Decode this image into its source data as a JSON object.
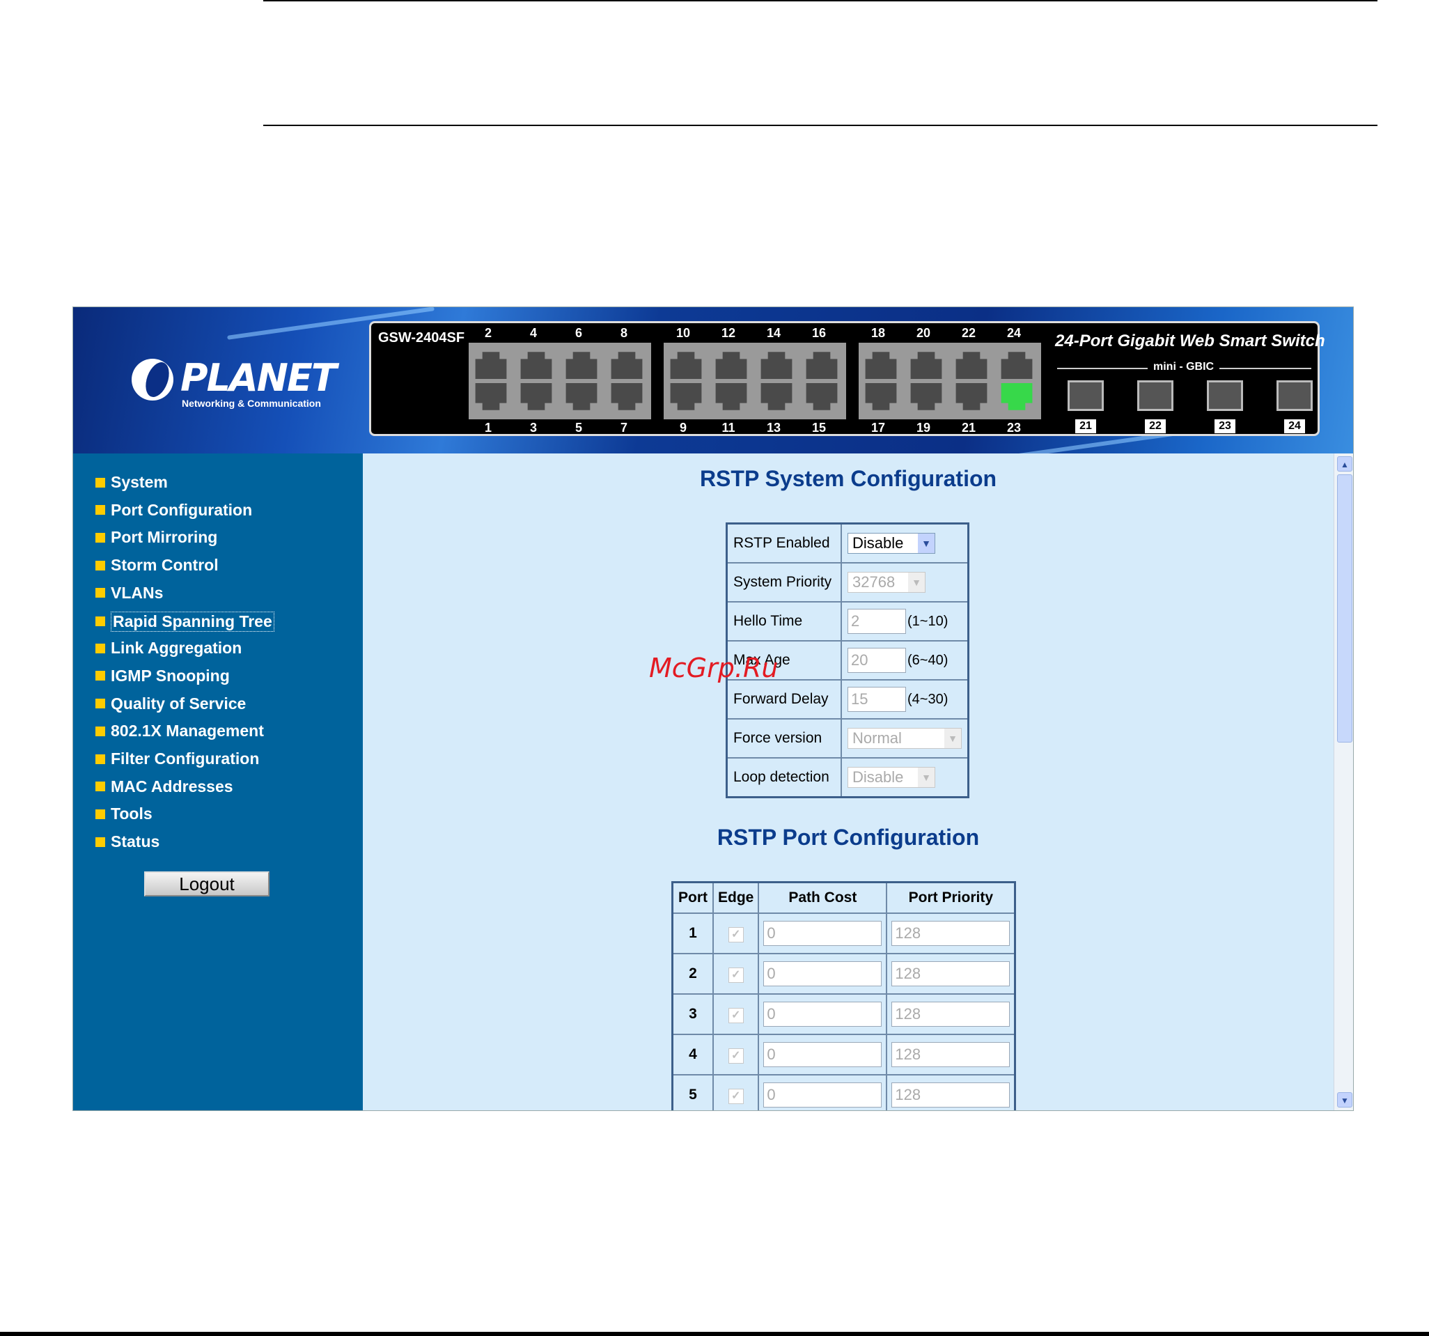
{
  "header": {
    "logo_text": "PLANET",
    "logo_subtitle": "Networking & Communication",
    "model": "GSW-2404SF",
    "switch_title": "24-Port Gigabit Web Smart Switch",
    "gbic_label": "mini - GBIC",
    "top_port_numbers": [
      "2",
      "4",
      "6",
      "8",
      "10",
      "12",
      "14",
      "16",
      "18",
      "20",
      "22",
      "24"
    ],
    "bottom_port_numbers": [
      "1",
      "3",
      "5",
      "7",
      "9",
      "11",
      "13",
      "15",
      "17",
      "19",
      "21",
      "23"
    ],
    "gbic_ports": [
      "21",
      "22",
      "23",
      "24"
    ],
    "active_port": "23",
    "active_color": "#37d84a"
  },
  "sidebar": {
    "items": [
      {
        "label": "System"
      },
      {
        "label": "Port Configuration"
      },
      {
        "label": "Port Mirroring"
      },
      {
        "label": "Storm Control"
      },
      {
        "label": "VLANs"
      },
      {
        "label": "Rapid Spanning Tree",
        "active": true
      },
      {
        "label": "Link Aggregation"
      },
      {
        "label": "IGMP Snooping"
      },
      {
        "label": "Quality of Service"
      },
      {
        "label": "802.1X Management"
      },
      {
        "label": "Filter Configuration"
      },
      {
        "label": "MAC Addresses"
      },
      {
        "label": "Tools"
      },
      {
        "label": "Status"
      }
    ],
    "logout_label": "Logout"
  },
  "system_config": {
    "title": "RSTP System Configuration",
    "rstp_enabled": {
      "label": "RSTP Enabled",
      "value": "Disable"
    },
    "system_priority": {
      "label": "System Priority",
      "value": "32768"
    },
    "hello_time": {
      "label": "Hello Time",
      "value": "2",
      "range": "(1~10)"
    },
    "max_age": {
      "label": "Max Age",
      "value": "20",
      "range": "(6~40)"
    },
    "forward_delay": {
      "label": "Forward Delay",
      "value": "15",
      "range": "(4~30)"
    },
    "force_version": {
      "label": "Force version",
      "value": "Normal"
    },
    "loop_detection": {
      "label": "Loop detection",
      "value": "Disable"
    }
  },
  "port_config": {
    "title": "RSTP Port Configuration",
    "columns": [
      "Port",
      "Edge",
      "Path Cost",
      "Port Priority"
    ],
    "rows": [
      {
        "port": "1",
        "edge": true,
        "path_cost": "0",
        "priority": "128"
      },
      {
        "port": "2",
        "edge": true,
        "path_cost": "0",
        "priority": "128"
      },
      {
        "port": "3",
        "edge": true,
        "path_cost": "0",
        "priority": "128"
      },
      {
        "port": "4",
        "edge": true,
        "path_cost": "0",
        "priority": "128"
      },
      {
        "port": "5",
        "edge": true,
        "path_cost": "0",
        "priority": "128"
      }
    ]
  },
  "watermark": "McGrp.Ru",
  "icons": {
    "dropdown": "chevron-down-icon",
    "check": "checkmark-icon",
    "scroll_up": "arrow-up-icon",
    "scroll_down": "arrow-down-icon"
  }
}
